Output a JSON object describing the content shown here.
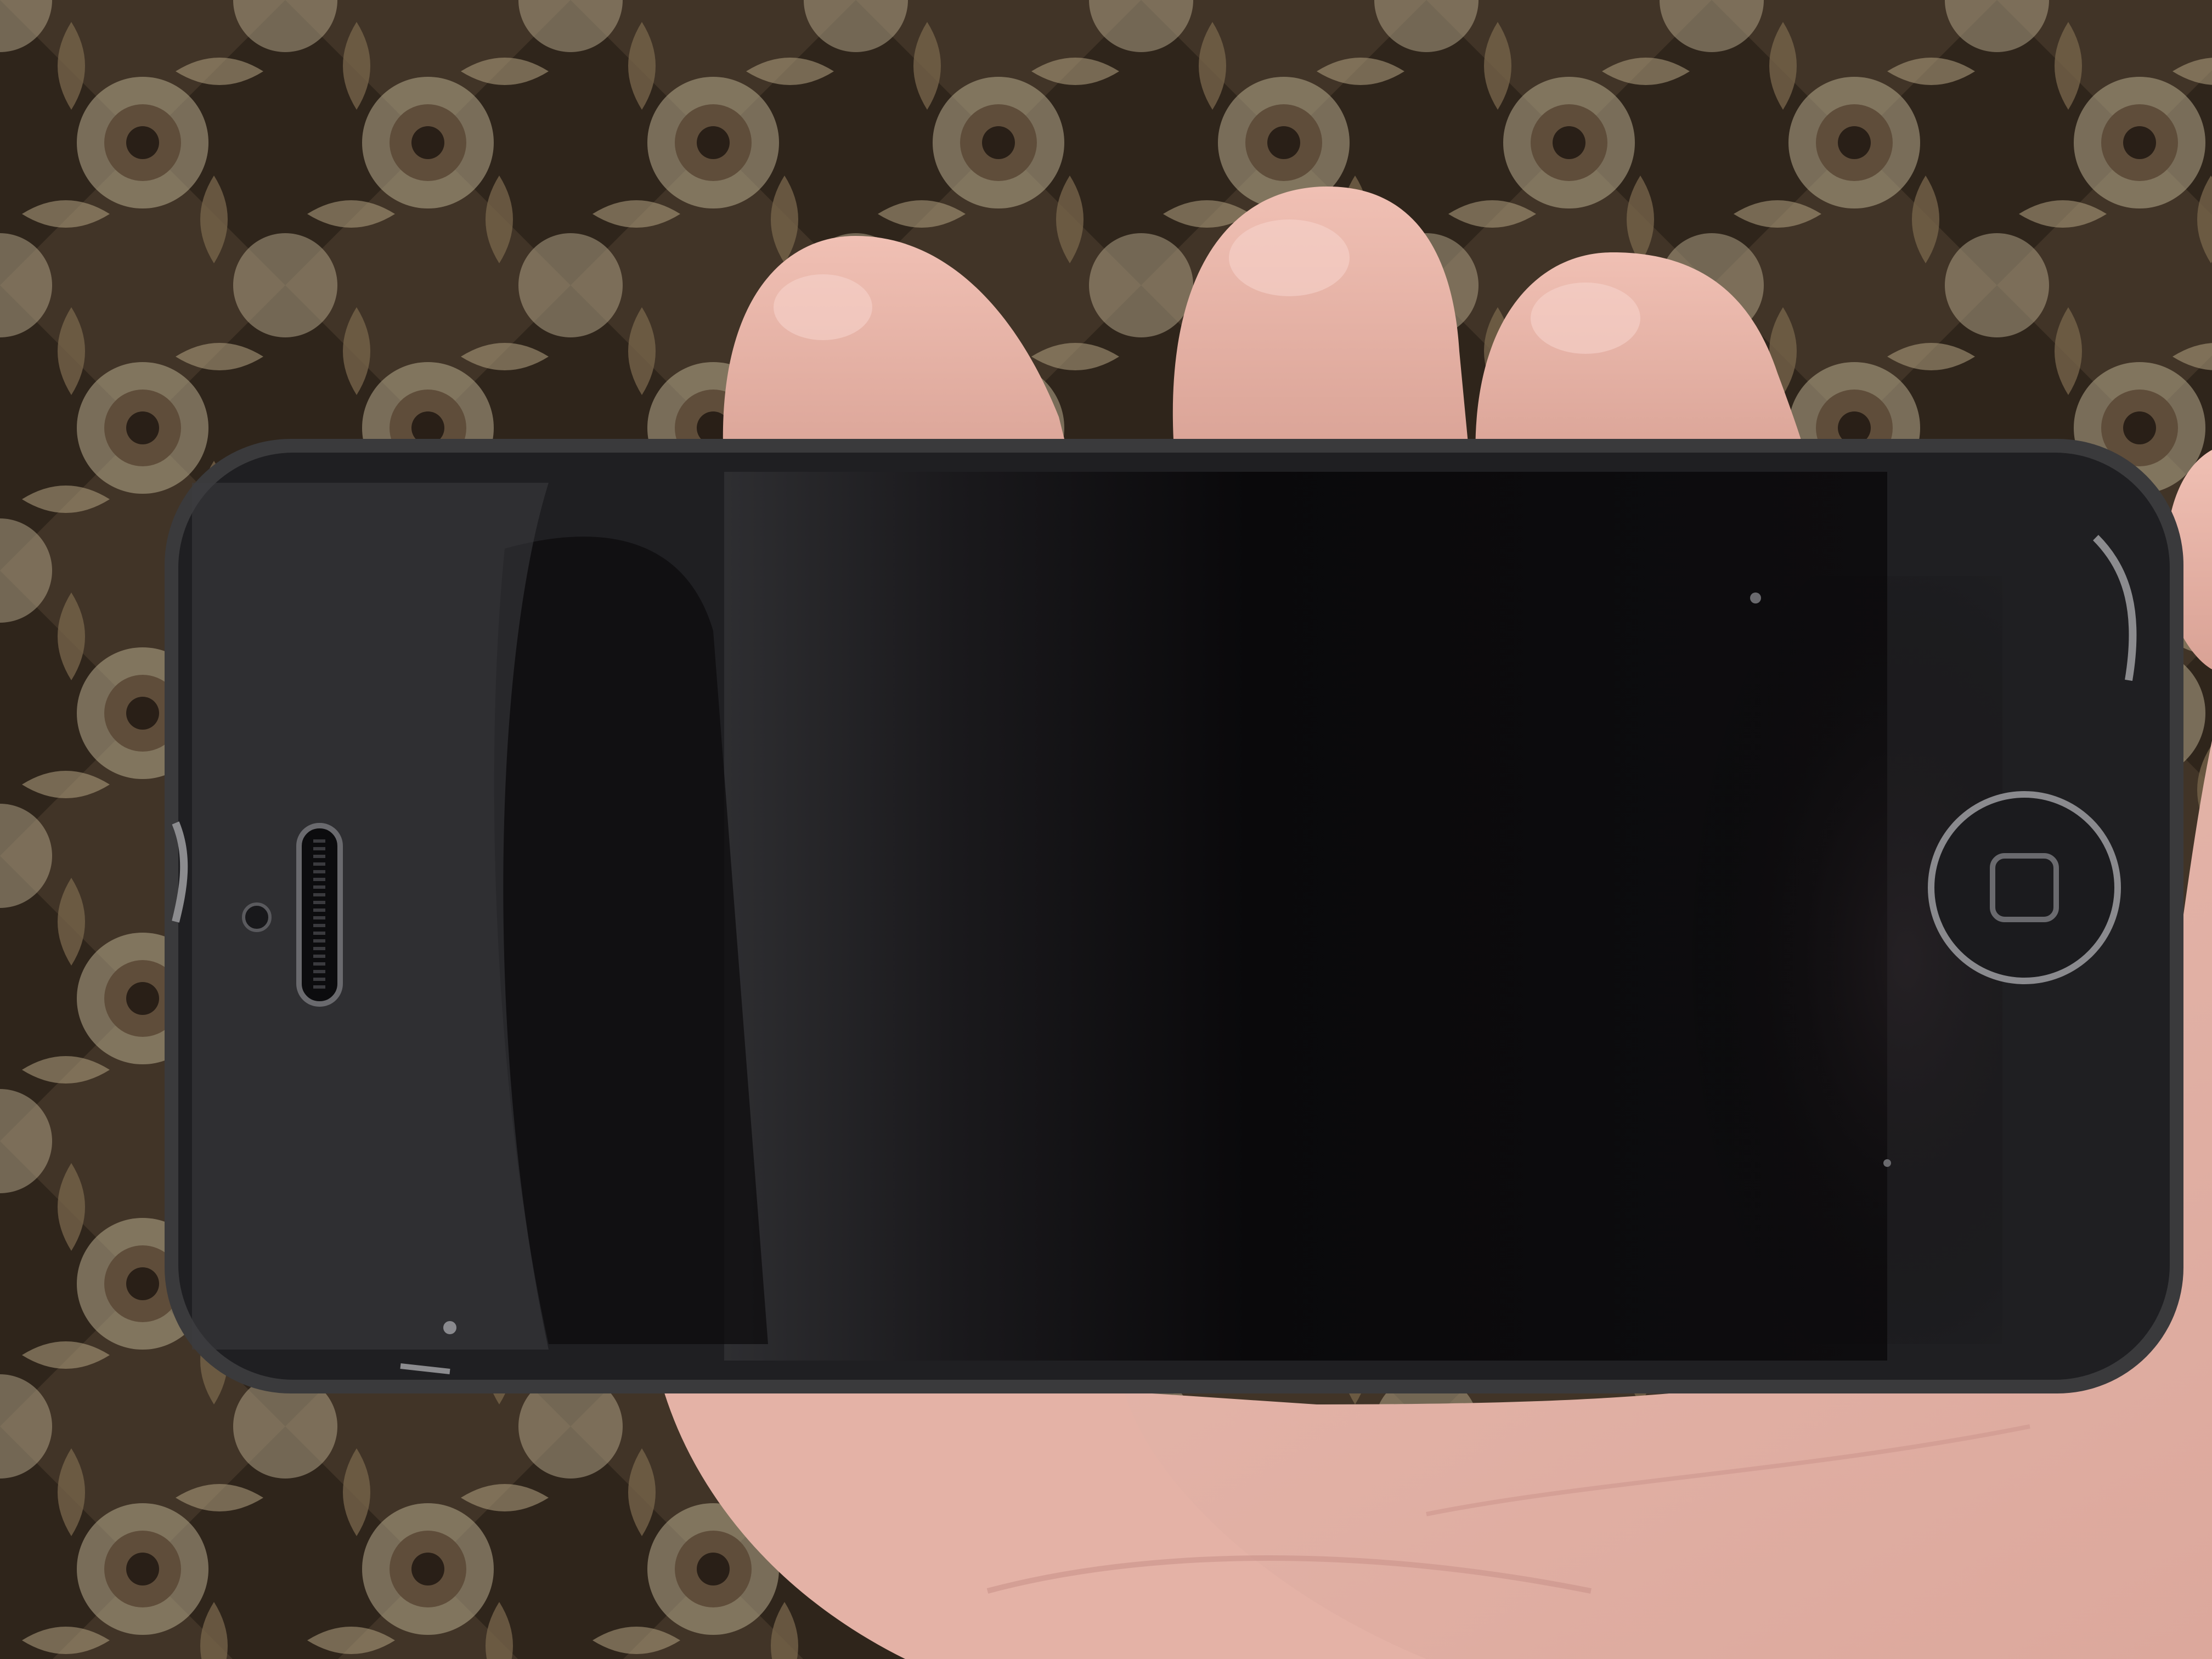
{
  "scene": {
    "subject": "smartphone",
    "colors": {
      "carpet_dark": "#2c2219",
      "carpet_mid": "#6e5a44",
      "carpet_light": "#d9c9a8",
      "skin": "#e6b3a8",
      "skin_shadow": "#c9928a",
      "phone_frame": "#3a3a3c",
      "phone_screen": "#0e0d0f",
      "phone_bezel": "#1f1f22"
    }
  }
}
